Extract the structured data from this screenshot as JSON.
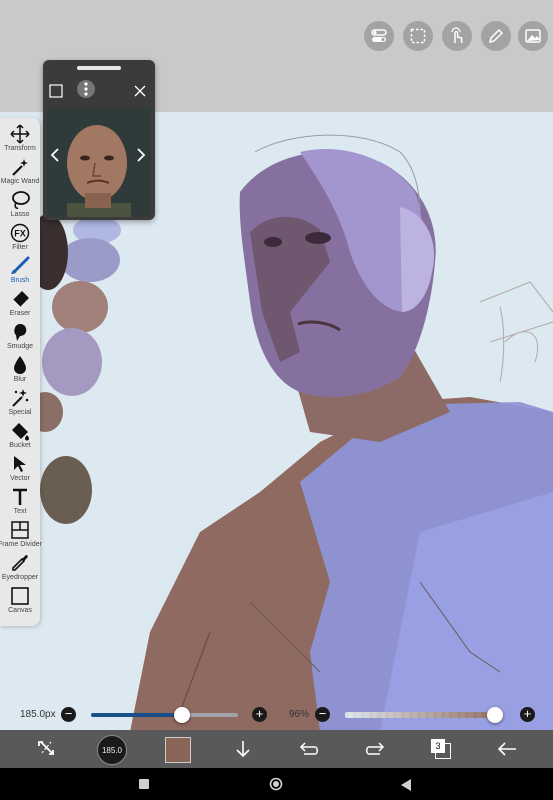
{
  "top_toolbar": {
    "buttons": [
      "toggle-icon",
      "selection-icon",
      "touch-icon",
      "pencil-icon",
      "image-icon"
    ]
  },
  "reference_window": {
    "controls": [
      "square-icon",
      "more-icon",
      "close-icon",
      "prev-icon",
      "next-icon"
    ]
  },
  "tools": [
    {
      "label": "Transform",
      "icon": "transform-icon"
    },
    {
      "label": "Magic Wand",
      "icon": "magic-wand-icon"
    },
    {
      "label": "Lasso",
      "icon": "lasso-icon"
    },
    {
      "label": "Filter",
      "icon": "fx-icon"
    },
    {
      "label": "Brush",
      "icon": "brush-icon",
      "active": true
    },
    {
      "label": "Eraser",
      "icon": "eraser-icon"
    },
    {
      "label": "Smudge",
      "icon": "smudge-icon"
    },
    {
      "label": "Blur",
      "icon": "blur-icon"
    },
    {
      "label": "Special",
      "icon": "special-icon"
    },
    {
      "label": "Bucket",
      "icon": "bucket-icon"
    },
    {
      "label": "Vector",
      "icon": "vector-icon"
    },
    {
      "label": "Text",
      "icon": "text-icon"
    },
    {
      "label": "Frame Divider",
      "icon": "frame-divider-icon"
    },
    {
      "label": "Eyedropper",
      "icon": "eyedropper-icon"
    },
    {
      "label": "Canvas",
      "icon": "canvas-icon"
    }
  ],
  "brush_size": {
    "label": "185.0px",
    "level": 0.62
  },
  "opacity": {
    "label": "96%",
    "level": 0.96
  },
  "bottom_bar": {
    "brush_preview_value": "185.0",
    "layer_count": "3",
    "color": "#8a6659",
    "icons": [
      "swap-icon",
      "brush-preview-icon",
      "color-swatch",
      "download-icon",
      "undo-icon",
      "redo-icon",
      "layers-icon",
      "back-icon"
    ]
  },
  "colors": {
    "accent": "#1c4f8a",
    "toolbar_bg": "#e8e8e8",
    "canvas_bg": "#dde9f0"
  }
}
